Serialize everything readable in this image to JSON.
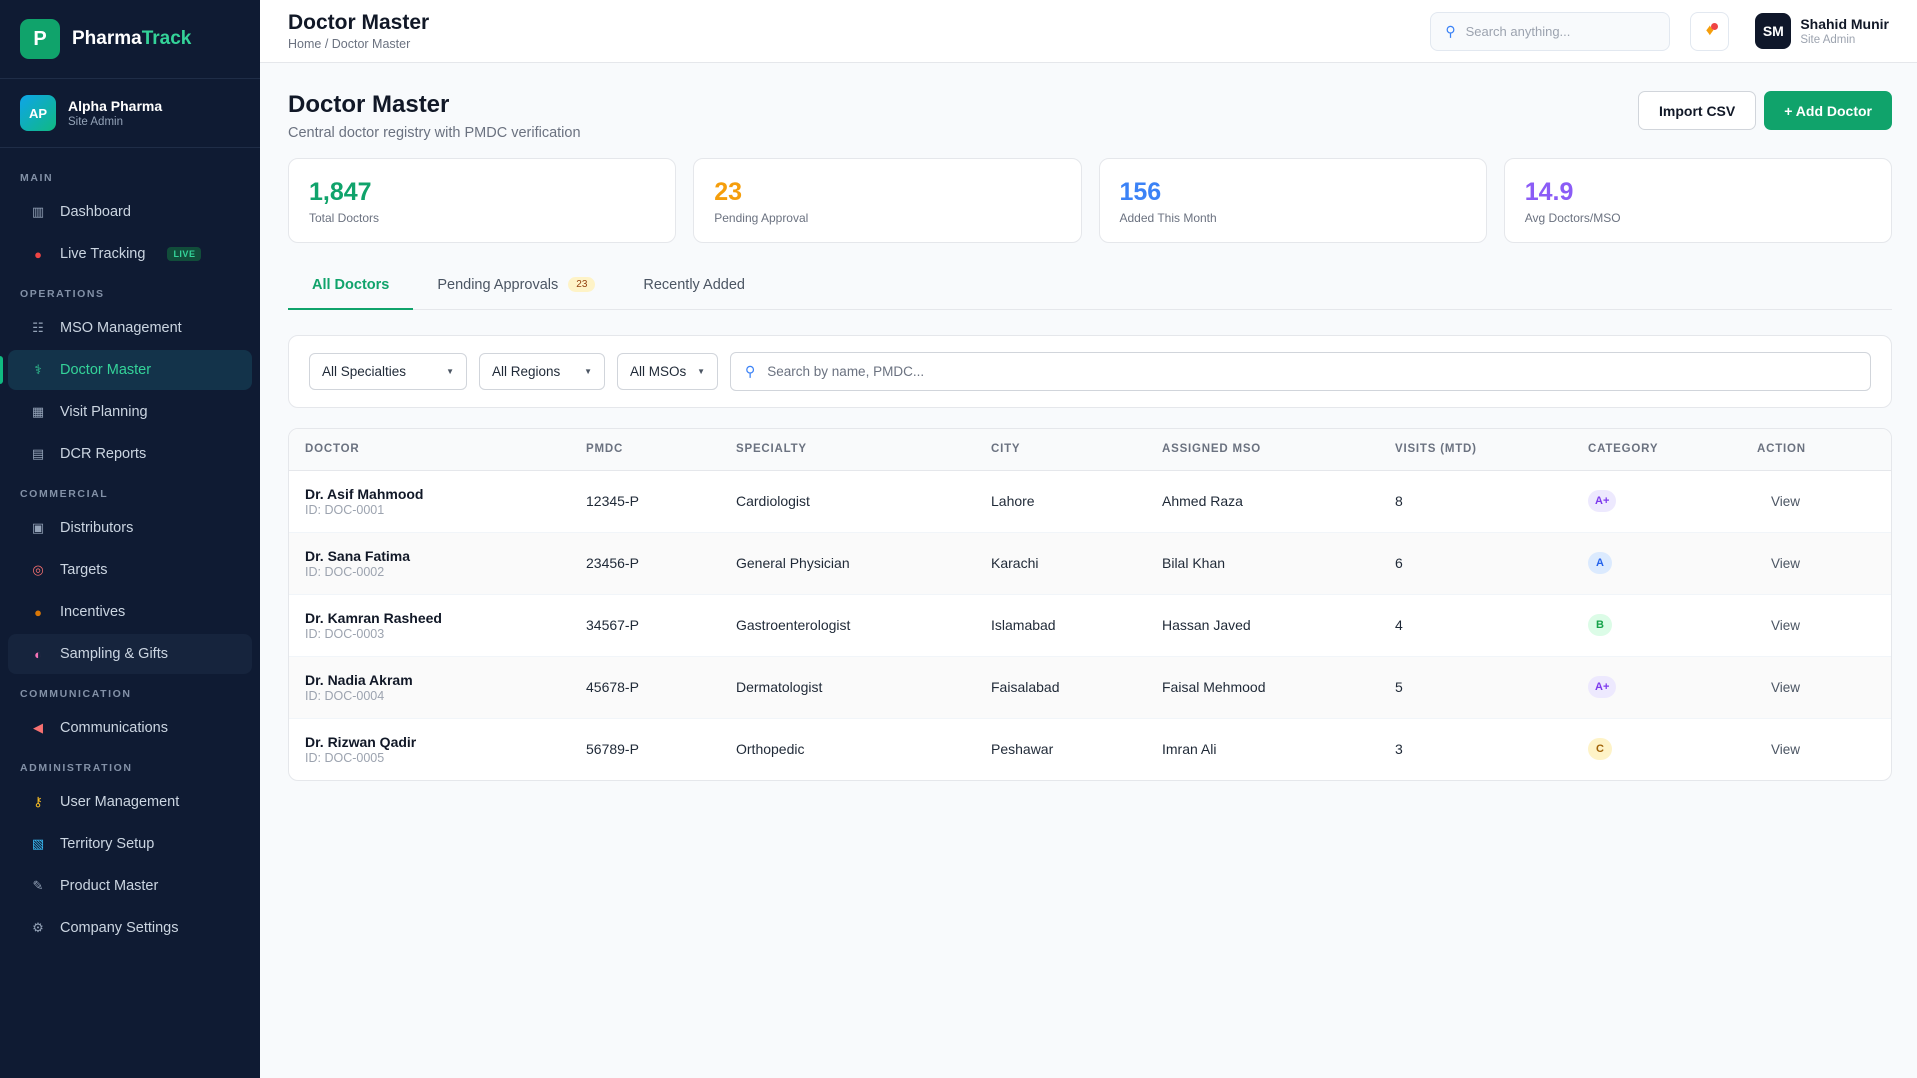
{
  "brand": {
    "logo_letter": "P",
    "name_main": "Pharma",
    "name_accent": "Track"
  },
  "org": {
    "initials": "AP",
    "name": "Alpha Pharma",
    "role": "Site Admin"
  },
  "nav": {
    "main_label": "MAIN",
    "dashboard": "Dashboard",
    "live_tracking": "Live Tracking",
    "live_badge": "LIVE",
    "operations_label": "OPERATIONS",
    "mso_management": "MSO Management",
    "doctor_master": "Doctor Master",
    "visit_planning": "Visit Planning",
    "dcr_reports": "DCR Reports",
    "commercial_label": "COMMERCIAL",
    "distributors": "Distributors",
    "targets": "Targets",
    "incentives": "Incentives",
    "sampling_gifts": "Sampling & Gifts",
    "communication_label": "COMMUNICATION",
    "communications": "Communications",
    "administration_label": "ADMINISTRATION",
    "user_management": "User Management",
    "territory_setup": "Territory Setup",
    "product_master": "Product Master",
    "company_settings": "Company Settings"
  },
  "topbar": {
    "title": "Doctor Master",
    "breadcrumb": "Home / Doctor Master",
    "search_placeholder": "Search anything...",
    "user_initials": "SM",
    "user_name": "Shahid Munir",
    "user_role": "Site Admin"
  },
  "page": {
    "title": "Doctor Master",
    "subtitle": "Central doctor registry with PMDC verification",
    "import_label": "Import CSV",
    "add_label": "+ Add Doctor"
  },
  "stats": [
    {
      "value": "1,847",
      "label": "Total Doctors",
      "color": "#10a36b"
    },
    {
      "value": "23",
      "label": "Pending Approval",
      "color": "#f59e0b"
    },
    {
      "value": "156",
      "label": "Added This Month",
      "color": "#3b82f6"
    },
    {
      "value": "14.9",
      "label": "Avg Doctors/MSO",
      "color": "#8b5cf6"
    }
  ],
  "tabs": {
    "all": "All Doctors",
    "pending": "Pending Approvals",
    "pending_count": "23",
    "recent": "Recently Added"
  },
  "filters": {
    "specialty": "All Specialties",
    "region": "All Regions",
    "mso": "All MSOs",
    "search_placeholder": "Search by name, PMDC..."
  },
  "table": {
    "headers": {
      "doctor": "DOCTOR",
      "pmdc": "PMDC",
      "specialty": "SPECIALTY",
      "city": "CITY",
      "mso": "ASSIGNED MSO",
      "visits": "VISITS (MTD)",
      "category": "CATEGORY",
      "action": "ACTION"
    },
    "view_label": "View",
    "rows": [
      {
        "name": "Dr. Asif Mahmood",
        "id": "ID: DOC-0001",
        "pmdc": "12345-P",
        "specialty": "Cardiologist",
        "city": "Lahore",
        "mso": "Ahmed Raza",
        "visits": "8",
        "category": "A+"
      },
      {
        "name": "Dr. Sana Fatima",
        "id": "ID: DOC-0002",
        "pmdc": "23456-P",
        "specialty": "General Physician",
        "city": "Karachi",
        "mso": "Bilal Khan",
        "visits": "6",
        "category": "A"
      },
      {
        "name": "Dr. Kamran Rasheed",
        "id": "ID: DOC-0003",
        "pmdc": "34567-P",
        "specialty": "Gastroenterologist",
        "city": "Islamabad",
        "mso": "Hassan Javed",
        "visits": "4",
        "category": "B"
      },
      {
        "name": "Dr. Nadia Akram",
        "id": "ID: DOC-0004",
        "pmdc": "45678-P",
        "specialty": "Dermatologist",
        "city": "Faisalabad",
        "mso": "Faisal Mehmood",
        "visits": "5",
        "category": "A+"
      },
      {
        "name": "Dr. Rizwan Qadir",
        "id": "ID: DOC-0005",
        "pmdc": "56789-P",
        "specialty": "Orthopedic",
        "city": "Peshawar",
        "mso": "Imran Ali",
        "visits": "3",
        "category": "C"
      }
    ]
  }
}
